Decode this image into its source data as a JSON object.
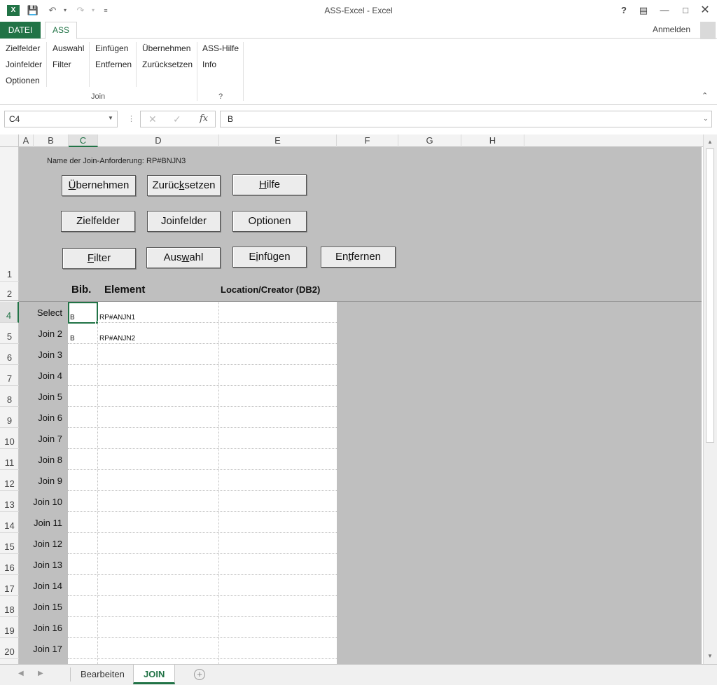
{
  "window": {
    "title": "ASS-Excel - Excel",
    "help": "?",
    "signin": "Anmelden"
  },
  "tabs": {
    "file": "DATEI",
    "ass": "ASS"
  },
  "ribbon": {
    "group1": [
      "Zielfelder",
      "Joinfelder",
      "Optionen"
    ],
    "group2": [
      "Auswahl",
      "Filter"
    ],
    "group3": [
      "Einfügen",
      "Entfernen"
    ],
    "group4": [
      "Übernehmen",
      "Zurücksetzen"
    ],
    "group_join_label": "Join",
    "group5": [
      "ASS-Hilfe",
      "Info"
    ],
    "group_help_label": "?"
  },
  "formula": {
    "namebox": "C4",
    "fx": "fx",
    "value": "B"
  },
  "columns": [
    "A",
    "B",
    "C",
    "D",
    "E",
    "F",
    "G",
    "H"
  ],
  "rows": [
    "1",
    "2",
    "4",
    "5",
    "6",
    "7",
    "8",
    "9",
    "10",
    "11",
    "12",
    "13",
    "14",
    "15",
    "16",
    "17",
    "18",
    "19",
    "20"
  ],
  "sheet": {
    "request_label": "Name der Join-Anforderung:",
    "request_value": "RP#BNJN3",
    "buttons": {
      "uebernehmen_pre": "",
      "uebernehmen_u": "Ü",
      "uebernehmen_post": "bernehmen",
      "zuruecksetzen_pre": "Zurüc",
      "zuruecksetzen_u": "k",
      "zuruecksetzen_post": "setzen",
      "hilfe_pre": "",
      "hilfe_u": "H",
      "hilfe_post": "ilfe",
      "zielfelder": "Zielfelder",
      "joinfelder": "Joinfelder",
      "optionen": "Optionen",
      "filter_pre": "",
      "filter_u": "F",
      "filter_post": "ilter",
      "auswahl_pre": "Aus",
      "auswahl_u": "w",
      "auswahl_post": "ahl",
      "einfuegen_pre": "E",
      "einfuegen_u": "i",
      "einfuegen_post": "nfügen",
      "entfernen_pre": "En",
      "entfernen_u": "t",
      "entfernen_post": "fernen"
    },
    "headers": {
      "bib": "Bib.",
      "element": "Element",
      "location": "Location/Creator (DB2)"
    },
    "row_labels": [
      "Select",
      "Join 2",
      "Join 3",
      "Join 4",
      "Join 5",
      "Join 6",
      "Join 7",
      "Join 8",
      "Join 9",
      "Join 10",
      "Join 11",
      "Join 12",
      "Join 13",
      "Join 14",
      "Join 15",
      "Join 16",
      "Join 17"
    ],
    "cells": [
      {
        "bib": "B",
        "element": "RP#ANJN1"
      },
      {
        "bib": "B",
        "element": "RP#ANJN2"
      }
    ]
  },
  "sheet_tabs": [
    "Bearbeiten",
    "JOIN"
  ],
  "colors": {
    "excel_green": "#217346",
    "sheet_gray": "#bfbfbf"
  }
}
